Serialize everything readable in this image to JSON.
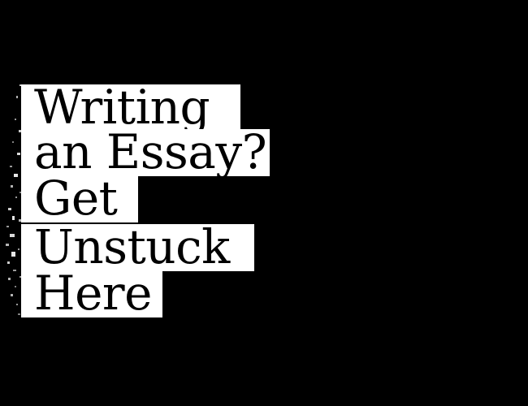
{
  "headline": {
    "lines": [
      "Writing",
      "an Essay?",
      "Get",
      "Unstuck",
      "Here"
    ]
  },
  "colors": {
    "background": "#000000",
    "text_box": "#ffffff",
    "text": "#000000"
  }
}
